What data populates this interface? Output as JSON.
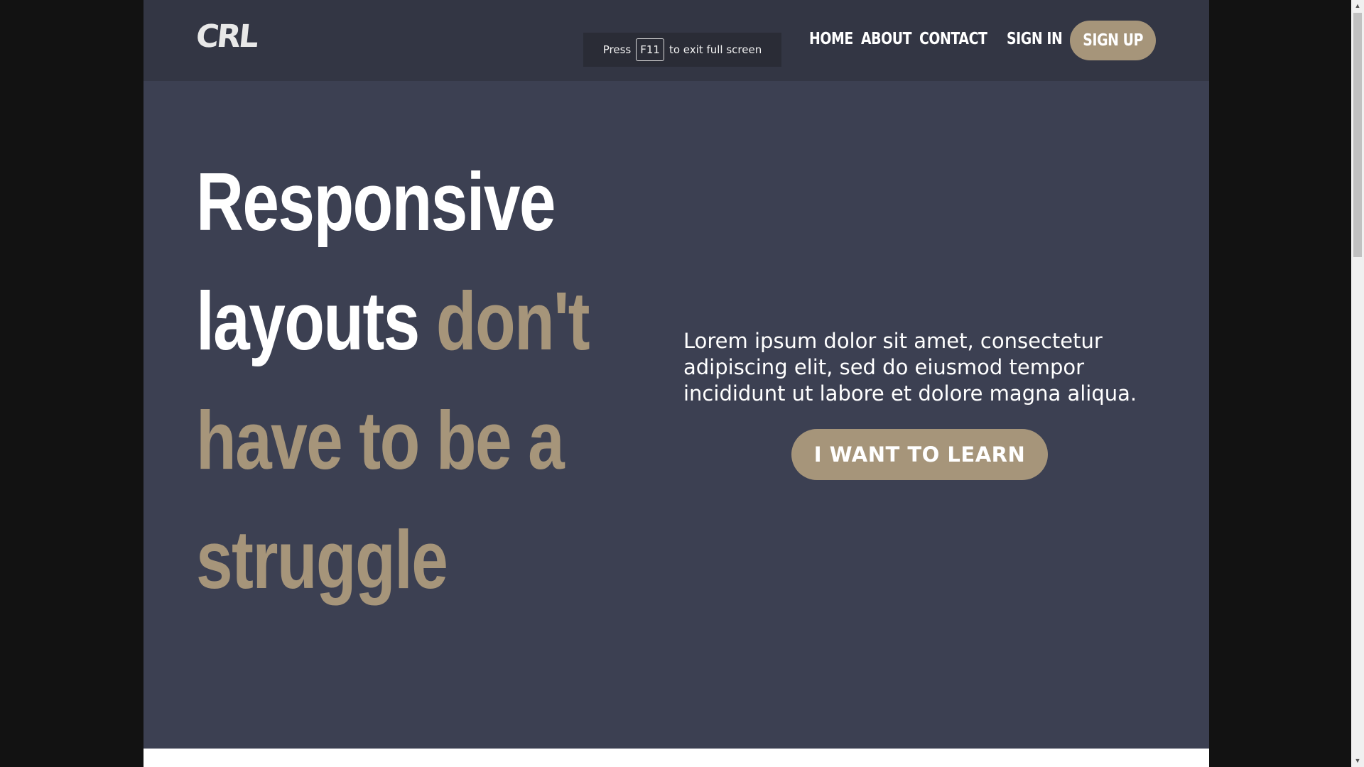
{
  "brand": {
    "logo": "CRL"
  },
  "fullscreen_hint": {
    "prefix": "Press",
    "key": "F11",
    "suffix": "to exit full screen"
  },
  "nav": {
    "home": "HOME",
    "about": "ABOUT",
    "contact": "CONTACT",
    "sign_in": "SIGN IN",
    "sign_up": "SIGN UP"
  },
  "hero": {
    "headline_line1": "Responsive",
    "headline_line2_white": "layouts",
    "headline_line2_accent": "don't",
    "headline_line3": "have to be a",
    "headline_line4": "struggle",
    "intro": "Lorem ipsum dolor sit amet, consectetur adipiscing elit, sed do eiusmod tempor incididunt ut labore et dolore magna aliqua.",
    "cta": "I WANT TO LEARN"
  },
  "colors": {
    "background": "#3c4052",
    "header": "#333644",
    "accent": "#a6957a",
    "text": "#ffffff"
  },
  "scrollbar": {
    "up_icon": "▲",
    "down_icon": "▼"
  }
}
